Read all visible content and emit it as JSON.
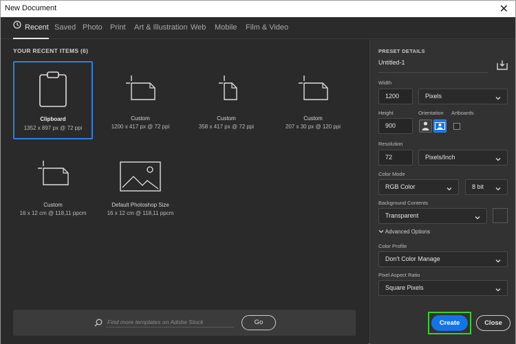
{
  "window": {
    "title": "New Document",
    "close_glyph": "✕"
  },
  "tabs": [
    {
      "label": "Recent",
      "active": true,
      "icon": "clock-icon"
    },
    {
      "label": "Saved"
    },
    {
      "label": "Photo"
    },
    {
      "label": "Print"
    },
    {
      "label": "Art & Illustration"
    },
    {
      "label": "Web"
    },
    {
      "label": "Mobile"
    },
    {
      "label": "Film & Video"
    }
  ],
  "recent": {
    "title": "YOUR RECENT ITEMS  (6)",
    "items": [
      {
        "name": "Clipboard",
        "dims": "1352 x 897 px @ 72 ppi",
        "icon": "clipboard-icon",
        "selected": true
      },
      {
        "name": "Custom",
        "dims": "1200 x 417 px @ 72 ppi",
        "icon": "custom-document-icon"
      },
      {
        "name": "Custom",
        "dims": "358 x 417 px @ 72 ppi",
        "icon": "custom-document-icon"
      },
      {
        "name": "Custom",
        "dims": "207 x 30 px @ 120 ppi",
        "icon": "custom-document-icon"
      },
      {
        "name": "Custom",
        "dims": "16 x 12 cm @ 118,11 ppcm",
        "icon": "custom-document-icon"
      },
      {
        "name": "Default Photoshop Size",
        "dims": "16 x 12 cm @ 118,11 ppcm",
        "icon": "image-icon"
      }
    ]
  },
  "search": {
    "placeholder": "Find more templates on Adobe Stock",
    "go_label": "Go"
  },
  "preset": {
    "header": "PRESET DETAILS",
    "doc_name": "Untitled-1",
    "width_label": "Width",
    "width_value": "1200",
    "width_unit": "Pixels",
    "height_label": "Height",
    "height_value": "900",
    "orientation_label": "Orientation",
    "artboards_label": "Artboards",
    "resolution_label": "Resolution",
    "resolution_value": "72",
    "resolution_unit": "Pixels/Inch",
    "color_mode_label": "Color Mode",
    "color_mode": "RGB Color",
    "bit_depth": "8 bit",
    "background_label": "Background Contents",
    "background": "Transparent",
    "advanced_label": "Advanced Options",
    "color_profile_label": "Color Profile",
    "color_profile": "Don't Color Manage",
    "pixel_aspect_label": "Pixel Aspect Ratio",
    "pixel_aspect": "Square Pixels"
  },
  "buttons": {
    "create": "Create",
    "close": "Close"
  },
  "colors": {
    "accent": "#1473e6",
    "selection": "#2f7fe6",
    "highlight_box": "#39d12c"
  }
}
